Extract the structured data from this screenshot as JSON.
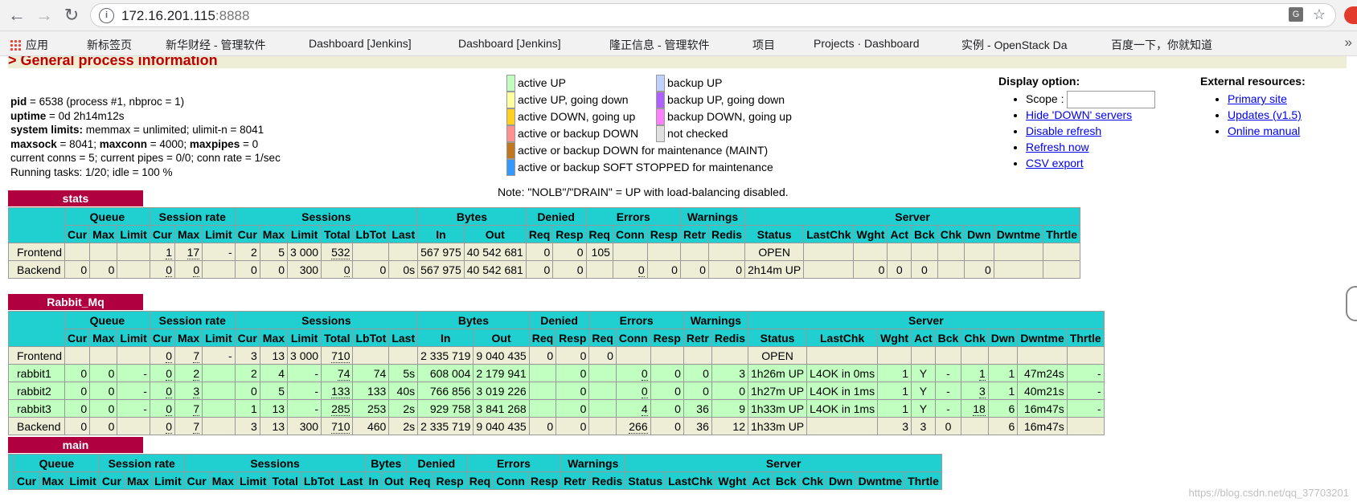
{
  "browser": {
    "url_host": "172.16.201.115",
    "url_port": ":8888",
    "bookmarks": [
      "应用",
      "新标签页",
      "新华财经 - 管理软件",
      "Dashboard [Jenkins]",
      "Dashboard [Jenkins]",
      "隆正信息 - 管理软件",
      "项目",
      "Projects · Dashboard",
      "实例 - OpenStack Da",
      "百度一下，你就知道"
    ],
    "icons": [
      "back-icon",
      "forward-icon",
      "reload-icon",
      "info-icon",
      "translate-icon",
      "star-icon",
      "apps-icon",
      "page-icon"
    ]
  },
  "section_title": "> General process information",
  "process_info": {
    "pid_label": "pid",
    "pid_value": " = 6538 (process #1, nbproc = 1)",
    "uptime_label": "uptime",
    "uptime_value": " = 0d 2h14m12s",
    "syslimits_label": "system limits:",
    "syslimits_value": " memmax = unlimited; ulimit-n = 8041",
    "maxsock_label": "maxsock",
    "maxsock_value": " = 8041; ",
    "maxconn_label": "maxconn",
    "maxconn_value": " = 4000; ",
    "maxpipes_label": "maxpipes",
    "maxpipes_value": " = 0",
    "conns_line": "current conns = 5; current pipes = 0/0; conn rate = 1/sec",
    "tasks_line": "Running tasks: 1/20; idle = 100 %"
  },
  "legend": {
    "items": [
      {
        "label": "active UP",
        "color": "#c0ffc0"
      },
      {
        "label": "active UP, going down",
        "color": "#ffffa0"
      },
      {
        "label": "active DOWN, going up",
        "color": "#ffd020"
      },
      {
        "label": "active or backup DOWN",
        "color": "#ff9090"
      },
      {
        "label": "active or backup DOWN for maintenance (MAINT)",
        "color": "#c07820"
      },
      {
        "label": "active or backup SOFT STOPPED for maintenance",
        "color": "#3399ff"
      },
      {
        "label": "backup UP",
        "color": "#c0d0ff"
      },
      {
        "label": "backup UP, going down",
        "color": "#b060ff"
      },
      {
        "label": "backup DOWN, going up",
        "color": "#ff80ff"
      },
      {
        "label": "not checked",
        "color": "#e0e0e0"
      }
    ],
    "note": "Note: \"NOLB\"/\"DRAIN\" = UP with load-balancing disabled."
  },
  "display_option": {
    "heading": "Display option:",
    "scope_label": "Scope :",
    "links": [
      "Hide 'DOWN' servers",
      "Disable refresh",
      "Refresh now",
      "CSV export"
    ]
  },
  "external": {
    "heading": "External resources:",
    "links": [
      "Primary site",
      "Updates (v1.5)",
      "Online manual"
    ]
  },
  "table_groups": [
    "Queue",
    "Session rate",
    "Sessions",
    "Bytes",
    "Denied",
    "Errors",
    "Warnings",
    "Server"
  ],
  "table_cols": [
    "Cur",
    "Max",
    "Limit",
    "Cur",
    "Max",
    "Limit",
    "Cur",
    "Max",
    "Limit",
    "Total",
    "LbTot",
    "Last",
    "In",
    "Out",
    "Req",
    "Resp",
    "Req",
    "Conn",
    "Resp",
    "Retr",
    "Redis",
    "Status",
    "LastChk",
    "Wght",
    "Act",
    "Bck",
    "Chk",
    "Dwn",
    "Dwntme",
    "Thrtle"
  ],
  "proxies": [
    {
      "name": "stats",
      "rows": [
        {
          "kind": "frontend",
          "cells": [
            "Frontend",
            "",
            "",
            "",
            "1",
            "17",
            "-",
            "2",
            "5",
            "3 000",
            "532",
            "",
            "",
            "567 975",
            "40 542 681",
            "0",
            "0",
            "105",
            "",
            "",
            "",
            "",
            "OPEN",
            "",
            "",
            "",
            "",
            "",
            "",
            "",
            ""
          ]
        },
        {
          "kind": "backend",
          "cells": [
            "Backend",
            "0",
            "0",
            "",
            "0",
            "0",
            "",
            "0",
            "0",
            "300",
            "0",
            "0",
            "0s",
            "567 975",
            "40 542 681",
            "0",
            "0",
            "",
            "0",
            "0",
            "0",
            "0",
            "2h14m UP",
            "",
            "0",
            "0",
            "0",
            "",
            "0",
            "",
            ""
          ]
        }
      ]
    },
    {
      "name": "Rabbit_Mq",
      "rows": [
        {
          "kind": "frontend",
          "cells": [
            "Frontend",
            "",
            "",
            "",
            "0",
            "7",
            "-",
            "3",
            "13",
            "3 000",
            "710",
            "",
            "",
            "2 335 719",
            "9 040 435",
            "0",
            "0",
            "0",
            "",
            "",
            "",
            "",
            "OPEN",
            "",
            "",
            "",
            "",
            "",
            "",
            "",
            ""
          ]
        },
        {
          "kind": "up",
          "cells": [
            "rabbit1",
            "0",
            "0",
            "-",
            "0",
            "2",
            "",
            "2",
            "4",
            "-",
            "74",
            "74",
            "5s",
            "608 004",
            "2 179 941",
            "",
            "0",
            "",
            "0",
            "0",
            "0",
            "3",
            "1h26m UP",
            "L4OK in 0ms",
            "1",
            "Y",
            "-",
            "1",
            "1",
            "47m24s",
            "-"
          ]
        },
        {
          "kind": "up",
          "cells": [
            "rabbit2",
            "0",
            "0",
            "-",
            "0",
            "3",
            "",
            "0",
            "5",
            "-",
            "133",
            "133",
            "40s",
            "766 856",
            "3 019 226",
            "",
            "0",
            "",
            "0",
            "0",
            "0",
            "0",
            "1h27m UP",
            "L4OK in 1ms",
            "1",
            "Y",
            "-",
            "3",
            "1",
            "40m21s",
            "-"
          ]
        },
        {
          "kind": "up",
          "cells": [
            "rabbit3",
            "0",
            "0",
            "-",
            "0",
            "7",
            "",
            "1",
            "13",
            "-",
            "285",
            "253",
            "2s",
            "929 758",
            "3 841 268",
            "",
            "0",
            "",
            "4",
            "0",
            "36",
            "9",
            "1h33m UP",
            "L4OK in 1ms",
            "1",
            "Y",
            "-",
            "18",
            "6",
            "16m47s",
            "-"
          ]
        },
        {
          "kind": "backend",
          "cells": [
            "Backend",
            "0",
            "0",
            "",
            "0",
            "7",
            "",
            "3",
            "13",
            "300",
            "710",
            "460",
            "2s",
            "2 335 719",
            "9 040 435",
            "0",
            "0",
            "",
            "266",
            "0",
            "36",
            "12",
            "1h33m UP",
            "",
            "3",
            "3",
            "0",
            "",
            "6",
            "16m47s",
            ""
          ]
        }
      ]
    },
    {
      "name": "main",
      "rows": []
    }
  ],
  "watermark": "https://blog.csdn.net/qq_37703201"
}
